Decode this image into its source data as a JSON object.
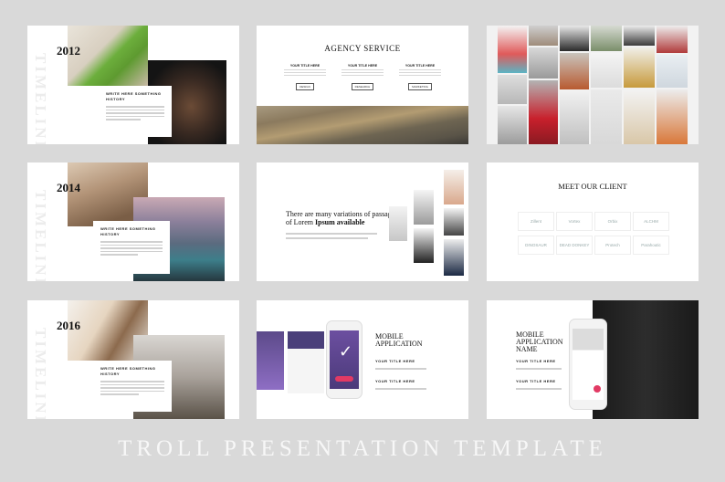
{
  "footer": {
    "title": "TROLL PRESENTATION TEMPLATE"
  },
  "timeline_word": "TIMELINE",
  "timeline_slides": [
    {
      "year": "2012",
      "card_title": "WRITE HERE SOMETHING HISTORY"
    },
    {
      "year": "2014",
      "card_title": "WRITE HERE SOMETHING HISTORY"
    },
    {
      "year": "2016",
      "card_title": "WRITE HERE SOMETHING HISTORY"
    }
  ],
  "agency": {
    "title": "AGENCY SERVICE",
    "columns": [
      {
        "title": "YOUR TITLE HERE",
        "button": "DESIGN"
      },
      {
        "title": "YOUR TITLE HERE",
        "button": "RESEARCH"
      },
      {
        "title": "YOUR TITLE HERE",
        "button": "MARKETING"
      }
    ]
  },
  "variations": {
    "headline_1": "There are many variations of passages",
    "headline_2_prefix": "of Lorem",
    "headline_2_bold": "Ipsum available"
  },
  "clients": {
    "title": "MEET OUR CLIENT",
    "logos": [
      "Zillent",
      "Vortex",
      "Orbix",
      "ALCHM",
      "DINOSAUR",
      "DEAD DONKEY",
      "Protech",
      "Parahoutic"
    ]
  },
  "mobile1": {
    "title_1": "MOBILE",
    "title_2": "APPLICATION",
    "item_title_1": "YOUR TITLE HERE",
    "item_title_2": "YOUR TITLE HERE"
  },
  "mobile2": {
    "title_1": "MOBILE",
    "title_2": "APPLICATION",
    "title_3": "NAME",
    "item_title_1": "YOUR TITLE HERE",
    "item_title_2": "YOUR TITLE HERE"
  },
  "colors": {
    "accent": "#e23a64",
    "background": "#d9d9d9"
  }
}
